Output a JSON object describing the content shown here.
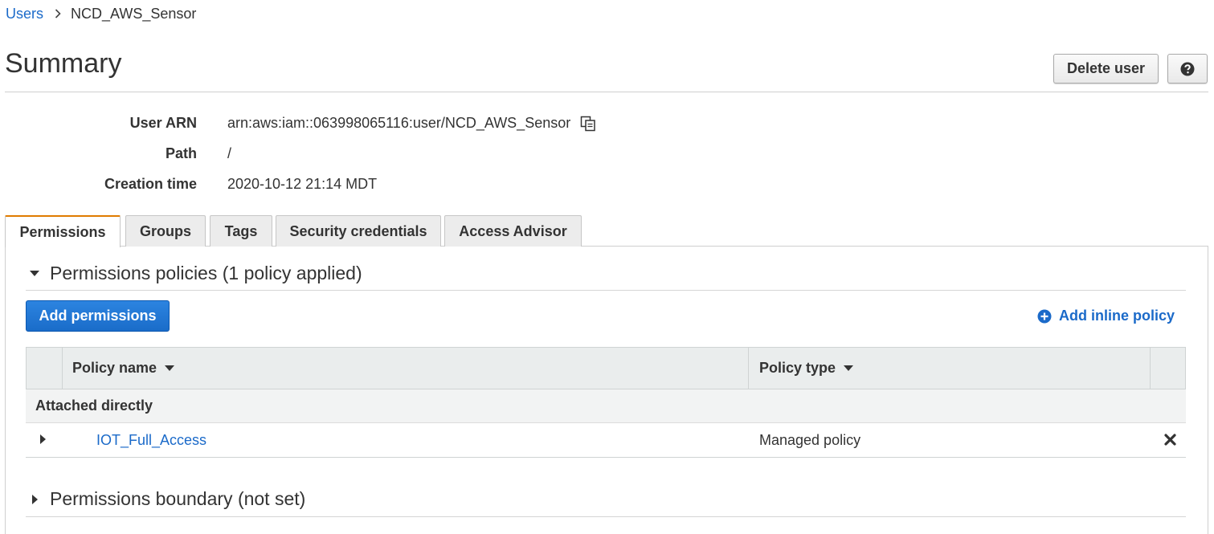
{
  "breadcrumb": {
    "parent": "Users",
    "current": "NCD_AWS_Sensor"
  },
  "header": {
    "title": "Summary",
    "delete_label": "Delete user",
    "help_icon": "question-circle-icon"
  },
  "summary": {
    "user_arn_label": "User ARN",
    "user_arn_value": "arn:aws:iam::063998065116:user/NCD_AWS_Sensor",
    "path_label": "Path",
    "path_value": "/",
    "creation_label": "Creation time",
    "creation_value": "2020-10-12 21:14 MDT"
  },
  "tabs": [
    {
      "label": "Permissions",
      "active": true
    },
    {
      "label": "Groups",
      "active": false
    },
    {
      "label": "Tags",
      "active": false
    },
    {
      "label": "Security credentials",
      "active": false
    },
    {
      "label": "Access Advisor",
      "active": false
    }
  ],
  "permissions": {
    "section_title": "Permissions policies (1 policy applied)",
    "add_permissions_label": "Add permissions",
    "add_inline_label": "Add inline policy",
    "table": {
      "col_policy_name": "Policy name",
      "col_policy_type": "Policy type",
      "group_label": "Attached directly",
      "rows": [
        {
          "name": "IOT_Full_Access",
          "type": "Managed policy"
        }
      ]
    },
    "boundary_title": "Permissions boundary (not set)"
  },
  "colors": {
    "link": "#1b6ac9",
    "primary_button": "#1a6cc9",
    "active_tab_accent": "#e07b00"
  }
}
